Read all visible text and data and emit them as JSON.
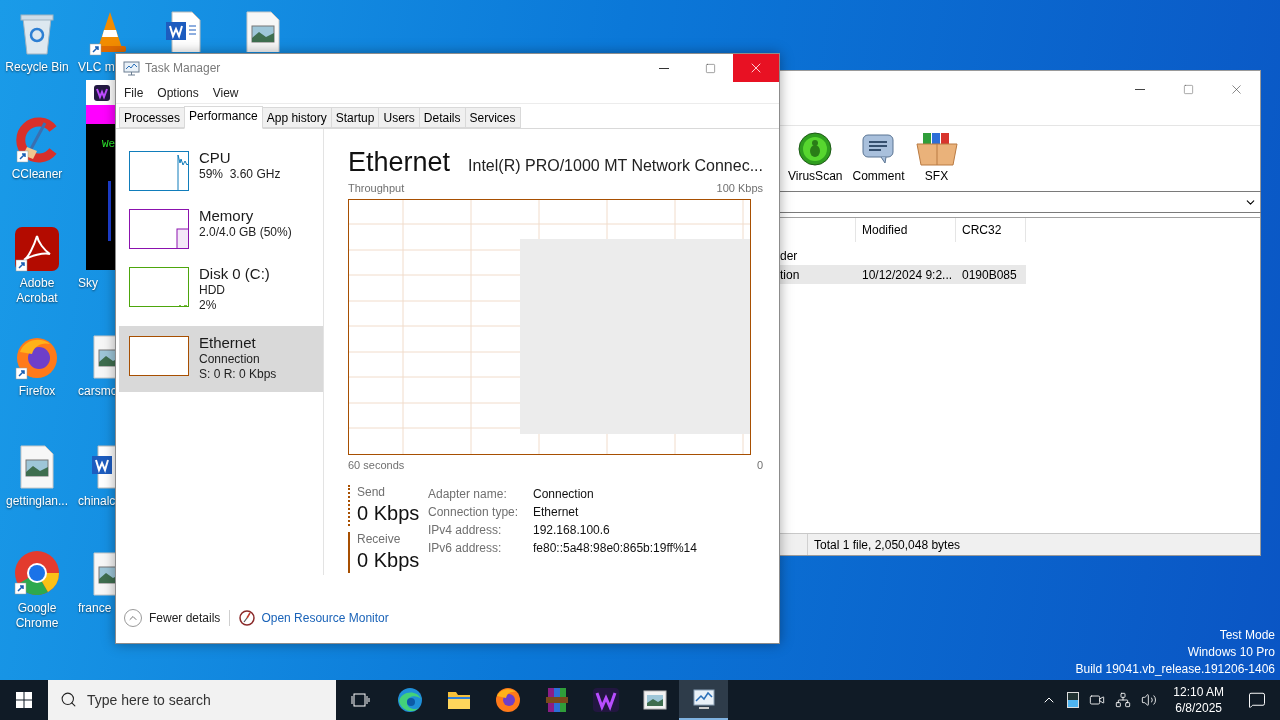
{
  "desktop": {
    "icons": [
      {
        "kind": "recycle",
        "label": "Recycle Bin"
      },
      {
        "kind": "vlc",
        "label": "VLC m"
      },
      {
        "kind": "word"
      },
      {
        "kind": "image"
      },
      {
        "kind": "ccleaner",
        "label": "CCleaner"
      },
      {
        "kind": "acrobat",
        "label": "Adobe Acrobat"
      },
      {
        "kind": "covered",
        "label": "Sky"
      },
      {
        "kind": "firefox",
        "label": "Firefox"
      },
      {
        "kind": "image",
        "label": "carsmc"
      },
      {
        "kind": "image",
        "label": "gettinglan..."
      },
      {
        "kind": "word",
        "label": "chinalc"
      },
      {
        "kind": "chrome",
        "label": "Google Chrome"
      },
      {
        "kind": "image",
        "label": "france"
      }
    ],
    "system_info": [
      "Test Mode",
      "Windows 10 Pro",
      "Build 19041.vb_release.191206-1406"
    ]
  },
  "terminal_window": {
    "text": "We"
  },
  "archiver_window": {
    "toolbar": [
      "VirusScan",
      "Comment",
      "SFX"
    ],
    "list": {
      "columns": [
        "Modified",
        "CRC32"
      ],
      "rows": [
        {
          "name": "der",
          "selected": false
        },
        {
          "name": "tion",
          "modified": "10/12/2024 9:2...",
          "crc32": "0190B085",
          "selected": true
        }
      ]
    },
    "status_bar": "Total 1 file, 2,050,048 bytes"
  },
  "task_manager": {
    "window": {
      "title": "Task Manager"
    },
    "menu": [
      "File",
      "Options",
      "View"
    ],
    "tabs": [
      {
        "label": "Processes",
        "selected": false
      },
      {
        "label": "Performance",
        "selected": true
      },
      {
        "label": "App history",
        "selected": false
      },
      {
        "label": "Startup",
        "selected": false
      },
      {
        "label": "Users",
        "selected": false
      },
      {
        "label": "Details",
        "selected": false
      },
      {
        "label": "Services",
        "selected": false
      }
    ],
    "sidebar": {
      "items": [
        {
          "kind": "cpu",
          "name": "CPU",
          "lines": [
            "59%  3.60 GHz"
          ],
          "color": "#117dbb",
          "selected": false
        },
        {
          "kind": "memory",
          "name": "Memory",
          "lines": [
            "2.0/4.0 GB (50%)"
          ],
          "color": "#8b12ae",
          "selected": false
        },
        {
          "kind": "disk",
          "name": "Disk 0 (C:)",
          "lines": [
            "HDD",
            "2%"
          ],
          "color": "#4da60c",
          "selected": false
        },
        {
          "kind": "network",
          "name": "Ethernet",
          "lines": [
            "Connection",
            "S: 0 R: 0 Kbps"
          ],
          "color": "#a74f01",
          "selected": true
        }
      ]
    },
    "detail": {
      "title": "Ethernet",
      "subtitle": "Intel(R) PRO/1000 MT Network Connec...",
      "graph_label": "Throughput",
      "graph_max": "100 Kbps",
      "graph_span": "60 seconds",
      "graph_min": "0",
      "stats": [
        {
          "kind": "send",
          "label": "Send",
          "value": "0 Kbps"
        },
        {
          "kind": "receive",
          "label": "Receive",
          "value": "0 Kbps"
        }
      ],
      "properties": [
        {
          "label": "Adapter name:",
          "value": "Connection"
        },
        {
          "label": "Connection type:",
          "value": "Ethernet"
        },
        {
          "label": "IPv4 address:",
          "value": "192.168.100.6"
        },
        {
          "label": "IPv6 address:",
          "value": "fe80::5a48:98e0:865b:19ff%14"
        }
      ]
    },
    "footer": {
      "fewer_details": "Fewer details",
      "resource_monitor": "Open Resource Monitor"
    }
  },
  "taskbar": {
    "search": {
      "placeholder": "Type here to search"
    },
    "apps": [
      {
        "kind": "task-view",
        "selected": false
      },
      {
        "kind": "edge",
        "selected": false
      },
      {
        "kind": "explorer",
        "selected": false
      },
      {
        "kind": "firefox",
        "selected": false
      },
      {
        "kind": "winrar",
        "selected": false
      },
      {
        "kind": "app",
        "selected": false
      },
      {
        "kind": "viewer",
        "selected": false
      },
      {
        "kind": "task-manager",
        "selected": true
      }
    ],
    "clock": {
      "time": "12:10 AM",
      "date": "6/8/2025"
    }
  }
}
